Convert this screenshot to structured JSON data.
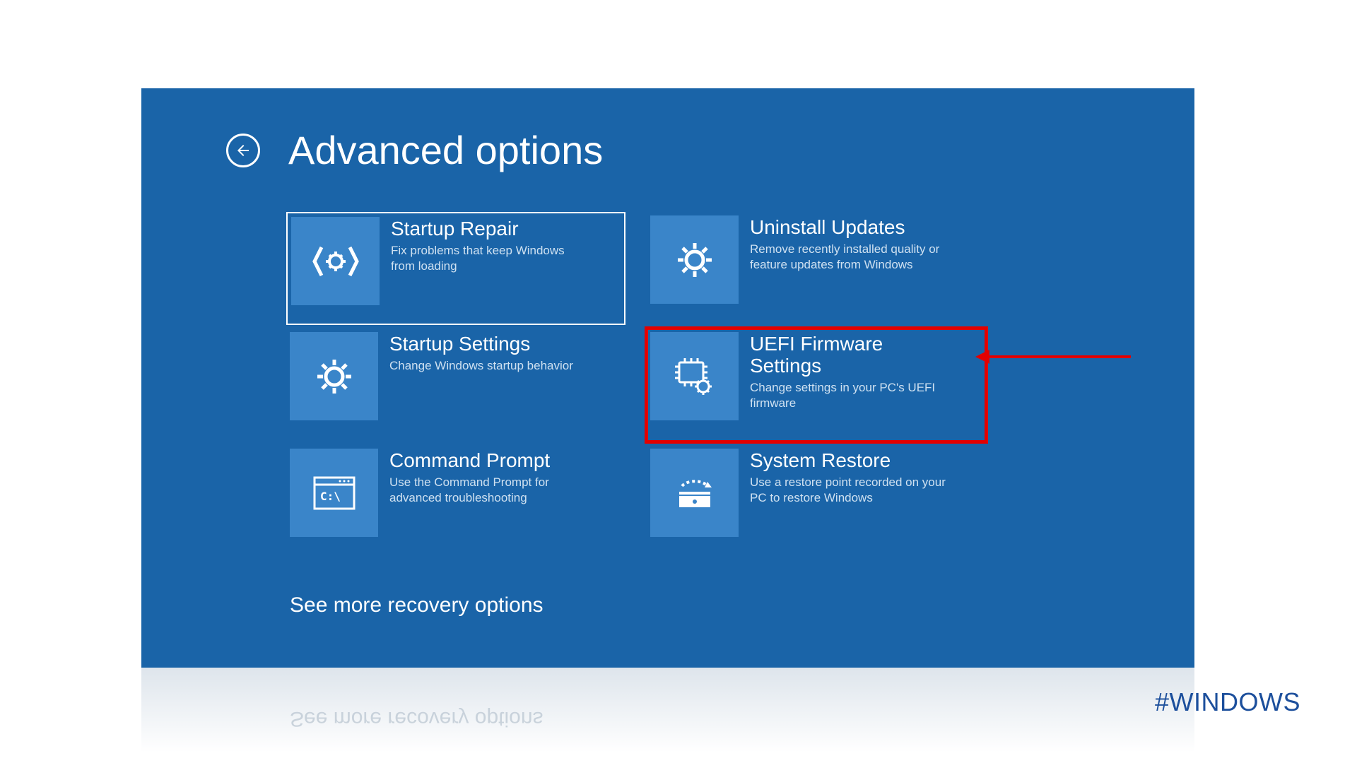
{
  "header": {
    "title": "Advanced options"
  },
  "tiles": {
    "startup_repair": {
      "title": "Startup Repair",
      "desc": "Fix problems that keep Windows from loading"
    },
    "uninstall_updates": {
      "title": "Uninstall Updates",
      "desc": "Remove recently installed quality or feature updates from Windows"
    },
    "startup_settings": {
      "title": "Startup Settings",
      "desc": "Change Windows startup behavior"
    },
    "uefi": {
      "title": "UEFI Firmware Settings",
      "desc": "Change settings in your PC's UEFI firmware"
    },
    "command_prompt": {
      "title": "Command Prompt",
      "desc": "Use the Command Prompt for advanced troubleshooting"
    },
    "system_restore": {
      "title": "System Restore",
      "desc": "Use a restore point recorded on your PC to restore Windows"
    }
  },
  "more_link": "See more recovery options",
  "reflection_text": "See more recovery options",
  "hashtag": "#WINDOWS"
}
